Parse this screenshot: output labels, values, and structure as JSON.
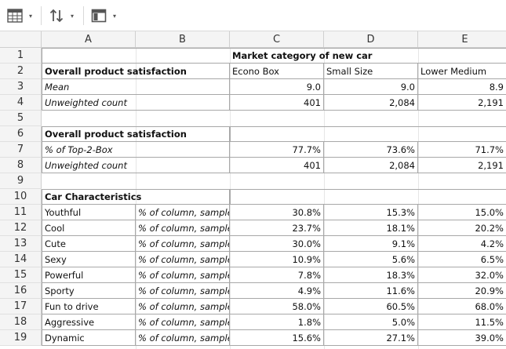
{
  "toolbar": {
    "buttons": [
      {
        "icon": "table-icon",
        "caret": "▾"
      },
      {
        "icon": "sort-arrows-icon",
        "caret": "▾"
      },
      {
        "icon": "window-icon",
        "caret": "▾"
      }
    ]
  },
  "columns": [
    "A",
    "B",
    "C",
    "D",
    "E"
  ],
  "rows": [
    "1",
    "2",
    "3",
    "4",
    "5",
    "6",
    "7",
    "8",
    "9",
    "10",
    "11",
    "12",
    "13",
    "14",
    "15",
    "16",
    "17",
    "18",
    "19"
  ],
  "sheet": {
    "r1": {
      "header": "Market category of new car"
    },
    "r2": {
      "title": "Overall product satisfaction",
      "c": "Econo Box",
      "d": "Small Size",
      "e": "Lower Medium"
    },
    "r3": {
      "label": "Mean",
      "c": "9.0",
      "d": "9.0",
      "e": "8.9"
    },
    "r4": {
      "label": "Unweighted count",
      "c": "401",
      "d": "2,084",
      "e": "2,191"
    },
    "r6": {
      "title": "Overall product satisfaction"
    },
    "r7": {
      "label": "% of Top-2-Box",
      "c": "77.7%",
      "d": "73.6%",
      "e": "71.7%"
    },
    "r8": {
      "label": "Unweighted count",
      "c": "401",
      "d": "2,084",
      "e": "2,191"
    },
    "r10": {
      "title": "Car Characteristics"
    },
    "characteristics": [
      {
        "name": "Youthful",
        "stat": "% of column, sample",
        "c": "30.8%",
        "d": "15.3%",
        "e": "15.0%"
      },
      {
        "name": "Cool",
        "stat": "% of column, sample",
        "c": "23.7%",
        "d": "18.1%",
        "e": "20.2%"
      },
      {
        "name": "Cute",
        "stat": "% of column, sample",
        "c": "30.0%",
        "d": "9.1%",
        "e": "4.2%"
      },
      {
        "name": "Sexy",
        "stat": "% of column, sample",
        "c": "10.9%",
        "d": "5.6%",
        "e": "6.5%"
      },
      {
        "name": "Powerful",
        "stat": "% of column, sample",
        "c": "7.8%",
        "d": "18.3%",
        "e": "32.0%"
      },
      {
        "name": "Sporty",
        "stat": "% of column, sample",
        "c": "4.9%",
        "d": "11.6%",
        "e": "20.9%"
      },
      {
        "name": "Fun to drive",
        "stat": "% of column, sample",
        "c": "58.0%",
        "d": "60.5%",
        "e": "68.0%"
      },
      {
        "name": "Aggressive",
        "stat": "% of column, sample",
        "c": "1.8%",
        "d": "5.0%",
        "e": "11.5%"
      },
      {
        "name": "Dynamic",
        "stat": "% of column, sample",
        "c": "15.6%",
        "d": "27.1%",
        "e": "39.0%"
      }
    ]
  }
}
